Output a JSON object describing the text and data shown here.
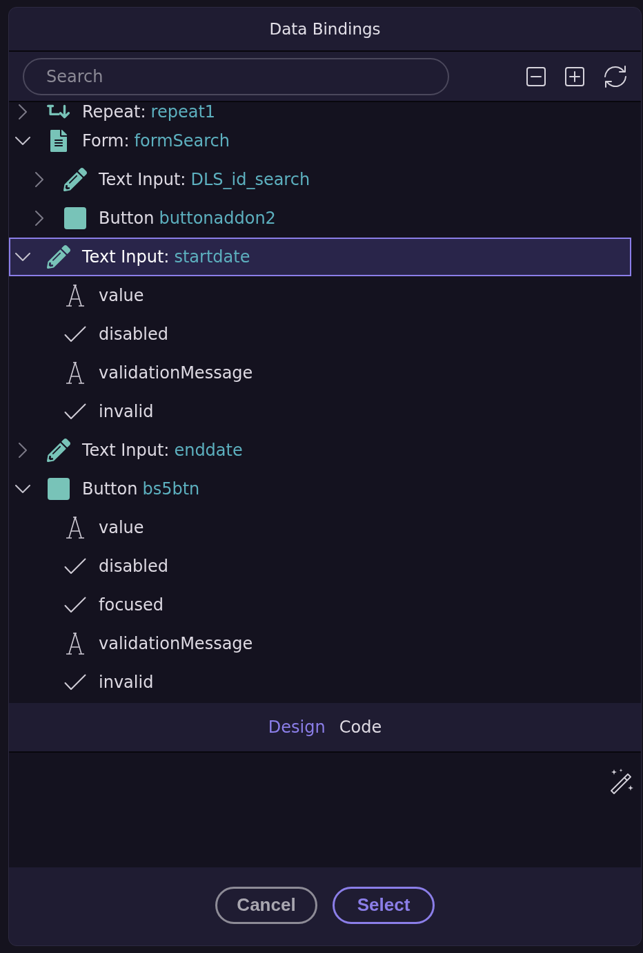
{
  "dialog": {
    "title": "Data Bindings"
  },
  "toolbar": {
    "search": {
      "placeholder": "Search"
    }
  },
  "tree": [
    {
      "kind": "repeat",
      "label": "Repeat:",
      "name": "repeat1",
      "expanded": false,
      "selected": false
    },
    {
      "kind": "form",
      "label": "Form:",
      "name": "formSearch",
      "expanded": true,
      "selected": false,
      "children": [
        {
          "kind": "text_input",
          "label": "Text Input:",
          "name": "DLS_id_search",
          "expanded": false,
          "selected": false
        },
        {
          "kind": "button",
          "label": "Button",
          "name": "buttonaddon2",
          "expanded": false,
          "selected": false
        }
      ]
    },
    {
      "kind": "text_input",
      "label": "Text Input:",
      "name": "startdate",
      "expanded": true,
      "selected": true,
      "children": [
        {
          "kind": "string",
          "label": "value",
          "selected": false
        },
        {
          "kind": "boolean",
          "label": "disabled",
          "selected": false
        },
        {
          "kind": "string",
          "label": "validationMessage",
          "selected": false
        },
        {
          "kind": "boolean",
          "label": "invalid",
          "selected": false
        }
      ]
    },
    {
      "kind": "text_input",
      "label": "Text Input:",
      "name": "enddate",
      "expanded": false,
      "selected": false
    },
    {
      "kind": "button",
      "label": "Button",
      "name": "bs5btn",
      "expanded": true,
      "selected": false,
      "children": [
        {
          "kind": "string",
          "label": "value",
          "selected": false
        },
        {
          "kind": "boolean",
          "label": "disabled",
          "selected": false
        },
        {
          "kind": "boolean",
          "label": "focused",
          "selected": false
        },
        {
          "kind": "string",
          "label": "validationMessage",
          "selected": false
        },
        {
          "kind": "boolean",
          "label": "invalid",
          "selected": false
        }
      ]
    }
  ],
  "tabs": [
    {
      "label": "Design",
      "selected": true
    },
    {
      "label": "Code",
      "selected": false
    }
  ],
  "buttons": [
    {
      "kind": "secondary",
      "label": "Cancel"
    },
    {
      "kind": "primary",
      "label": "Select"
    }
  ]
}
